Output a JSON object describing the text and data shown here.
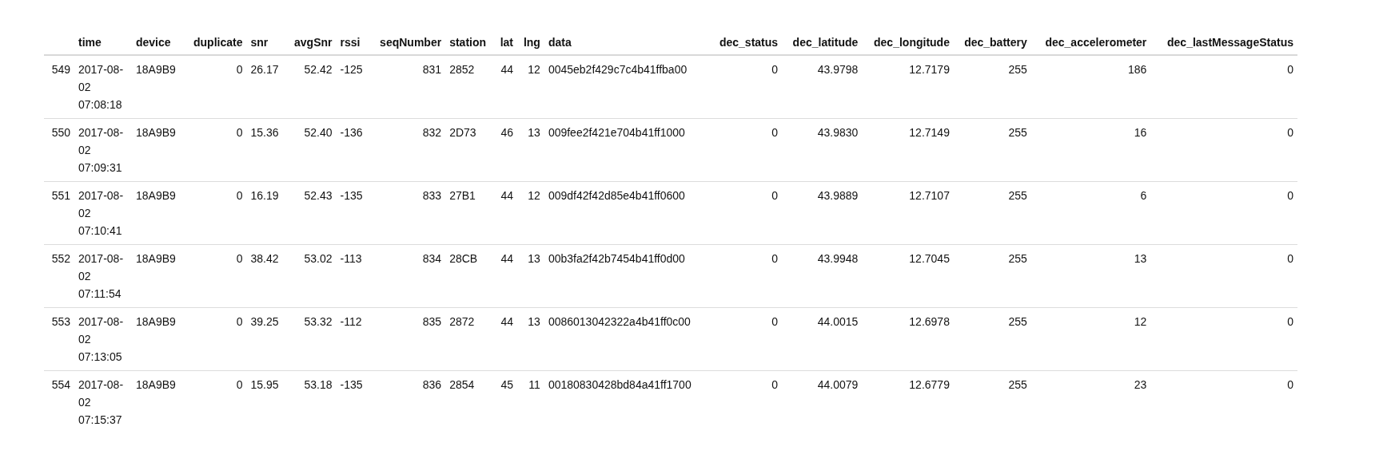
{
  "table": {
    "columns": [
      {
        "label": "time",
        "kind": "text"
      },
      {
        "label": "device",
        "kind": "text"
      },
      {
        "label": "duplicate",
        "kind": "number"
      },
      {
        "label": "snr",
        "kind": "text"
      },
      {
        "label": "avgSnr",
        "kind": "number"
      },
      {
        "label": "rssi",
        "kind": "text"
      },
      {
        "label": "seqNumber",
        "kind": "number"
      },
      {
        "label": "station",
        "kind": "text"
      },
      {
        "label": "lat",
        "kind": "number"
      },
      {
        "label": "lng",
        "kind": "number"
      },
      {
        "label": "data",
        "kind": "text"
      },
      {
        "label": "dec_status",
        "kind": "number"
      },
      {
        "label": "dec_latitude",
        "kind": "number"
      },
      {
        "label": "dec_longitude",
        "kind": "number"
      },
      {
        "label": "dec_battery",
        "kind": "number"
      },
      {
        "label": "dec_accelerometer",
        "kind": "number"
      },
      {
        "label": "dec_lastMessageStatus",
        "kind": "number"
      }
    ],
    "rows": [
      {
        "index": "549",
        "cells": [
          "2017-08-02 07:08:18",
          "18A9B9",
          "0",
          "26.17",
          "52.42",
          "-125",
          "831",
          "2852",
          "44",
          "12",
          "0045eb2f429c7c4b41ffba00",
          "0",
          "43.9798",
          "12.7179",
          "255",
          "186",
          "0"
        ]
      },
      {
        "index": "550",
        "cells": [
          "2017-08-02 07:09:31",
          "18A9B9",
          "0",
          "15.36",
          "52.40",
          "-136",
          "832",
          "2D73",
          "46",
          "13",
          "009fee2f421e704b41ff1000",
          "0",
          "43.9830",
          "12.7149",
          "255",
          "16",
          "0"
        ]
      },
      {
        "index": "551",
        "cells": [
          "2017-08-02 07:10:41",
          "18A9B9",
          "0",
          "16.19",
          "52.43",
          "-135",
          "833",
          "27B1",
          "44",
          "12",
          "009df42f42d85e4b41ff0600",
          "0",
          "43.9889",
          "12.7107",
          "255",
          "6",
          "0"
        ]
      },
      {
        "index": "552",
        "cells": [
          "2017-08-02 07:11:54",
          "18A9B9",
          "0",
          "38.42",
          "53.02",
          "-113",
          "834",
          "28CB",
          "44",
          "13",
          "00b3fa2f42b7454b41ff0d00",
          "0",
          "43.9948",
          "12.7045",
          "255",
          "13",
          "0"
        ]
      },
      {
        "index": "553",
        "cells": [
          "2017-08-02 07:13:05",
          "18A9B9",
          "0",
          "39.25",
          "53.32",
          "-112",
          "835",
          "2872",
          "44",
          "13",
          "0086013042322a4b41ff0c00",
          "0",
          "44.0015",
          "12.6978",
          "255",
          "12",
          "0"
        ]
      },
      {
        "index": "554",
        "cells": [
          "2017-08-02 07:15:37",
          "18A9B9",
          "0",
          "15.95",
          "53.18",
          "-135",
          "836",
          "2854",
          "45",
          "11",
          "00180830428bd84a41ff1700",
          "0",
          "44.0079",
          "12.6779",
          "255",
          "23",
          "0"
        ]
      }
    ]
  }
}
